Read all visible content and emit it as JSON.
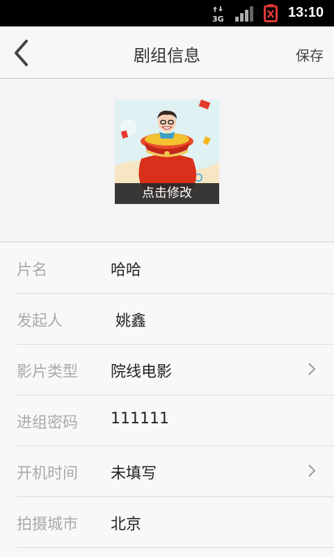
{
  "status_bar": {
    "network_label": "3G",
    "time": "13:10",
    "battery_color": "#e53935"
  },
  "header": {
    "title": "剧组信息",
    "save_label": "保存"
  },
  "avatar": {
    "edit_label": "点击修改"
  },
  "form": {
    "rows": [
      {
        "label": "片名",
        "value": "哈哈"
      },
      {
        "label": "发起人",
        "value": " 姚鑫"
      },
      {
        "label": "影片类型",
        "value": "院线电影"
      },
      {
        "label": "进组密码",
        "value": "111111"
      },
      {
        "label": "开机时间",
        "value": "未填写"
      },
      {
        "label": "拍摄城市",
        "value": "北京"
      }
    ]
  },
  "colors": {
    "accent_red": "#e23b1c",
    "label_gray": "#a9a9a9"
  }
}
